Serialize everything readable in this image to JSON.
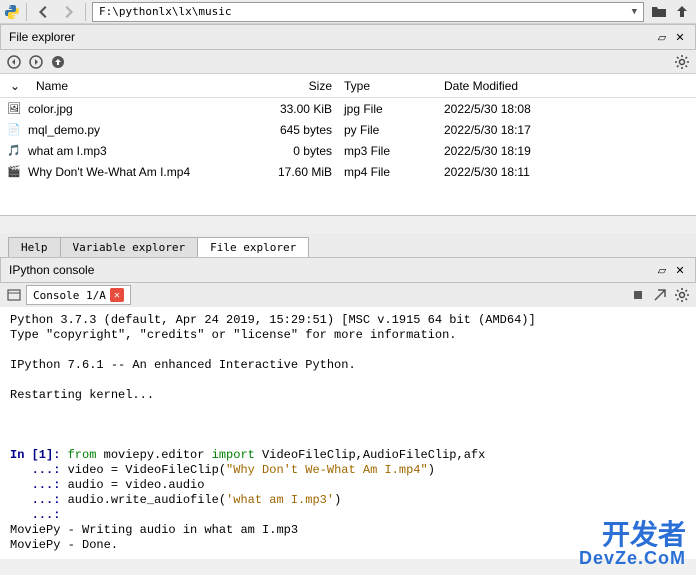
{
  "path": "F:\\pythonlx\\lx\\music",
  "file_explorer": {
    "title": "File explorer",
    "columns": {
      "name": "Name",
      "size": "Size",
      "type": "Type",
      "modified": "Date Modified"
    },
    "files": [
      {
        "name": "color.jpg",
        "size": "33.00 KiB",
        "type": "jpg File",
        "modified": "2022/5/30 18:08",
        "icon": "image"
      },
      {
        "name": "mql_demo.py",
        "size": "645 bytes",
        "type": "py File",
        "modified": "2022/5/30 18:17",
        "icon": "python"
      },
      {
        "name": "what am I.mp3",
        "size": "0 bytes",
        "type": "mp3 File",
        "modified": "2022/5/30 18:19",
        "icon": "audio"
      },
      {
        "name": "Why Don't We-What Am I.mp4",
        "size": "17.60 MiB",
        "type": "mp4 File",
        "modified": "2022/5/30 18:11",
        "icon": "video"
      }
    ]
  },
  "tabs": {
    "help": "Help",
    "variable_explorer": "Variable explorer",
    "file_explorer": "File explorer"
  },
  "console": {
    "title": "IPython console",
    "tab_label": "Console 1/A",
    "lines": {
      "l1": "Python 3.7.3 (default, Apr 24 2019, 15:29:51) [MSC v.1915 64 bit (AMD64)]",
      "l2": "Type \"copyright\", \"credits\" or \"license\" for more information.",
      "l3": "IPython 7.6.1 -- An enhanced Interactive Python.",
      "l4": "Restarting kernel...",
      "in_prompt": "In [1]: ",
      "cont_prompt": "   ...: ",
      "kw_from": "from",
      "mod": " moviepy.editor ",
      "kw_import": "import",
      "imports": " VideoFileClip,AudioFileClip,afx",
      "line2a": "video = VideoFileClip(",
      "str1": "\"Why Don't We-What Am I.mp4\"",
      "line2b": ")",
      "line3": "audio = video.audio",
      "line4a": "audio.write_audiofile(",
      "str2": "'what am I.mp3'",
      "line4b": ")",
      "out1": "MoviePy - Writing audio in what am I.mp3",
      "out2": "MoviePy - Done."
    }
  },
  "watermark": {
    "main": "开发者",
    "sub": "DevZe.CoM"
  }
}
